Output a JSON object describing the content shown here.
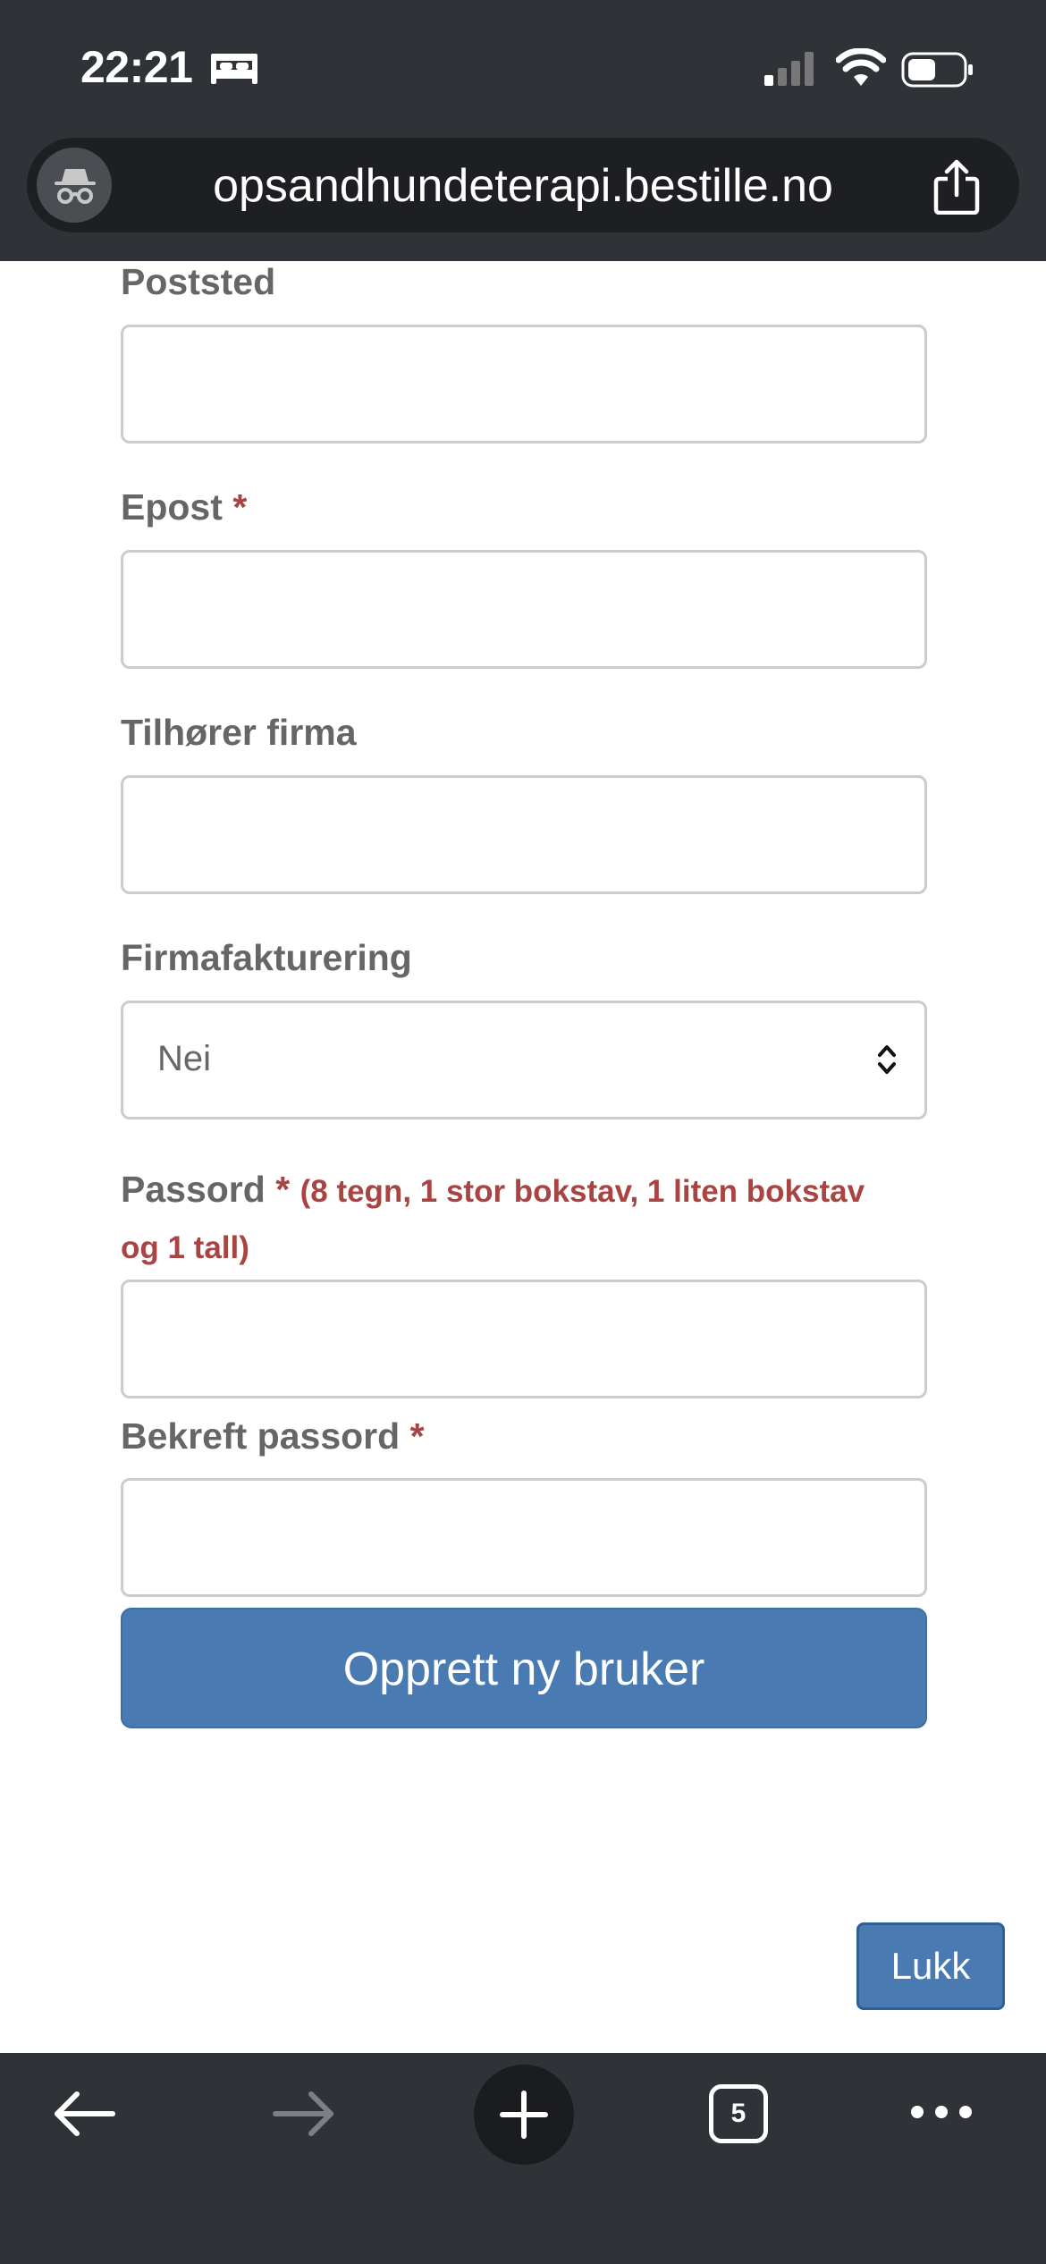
{
  "status_bar": {
    "time": "22:21",
    "icons": [
      "bed-icon",
      "signal-icon",
      "wifi-icon",
      "battery-icon"
    ]
  },
  "browser": {
    "url": "opsandhundeterapi.bestille.no",
    "left_icon": "incognito-icon",
    "right_icon": "share-icon"
  },
  "form": {
    "poststed_label": "Poststed",
    "epost_label": "Epost",
    "required_marker": "*",
    "firma_label": "Tilhører firma",
    "fakturering_label": "Firmafakturering",
    "fakturering_value": "Nei",
    "passord_label": "Passord",
    "passord_hint_line1": "(8 tegn, 1 stor bokstav, 1 liten bokstav",
    "passord_hint_line2": "og 1 tall)",
    "bekreft_label": "Bekreft passord",
    "submit_label": "Opprett ny bruker"
  },
  "modal_footer": {
    "close_label": "Lukk"
  },
  "toolbar": {
    "tab_count": "5",
    "icons": [
      "back-icon",
      "forward-icon",
      "new-tab-icon",
      "tabs-icon",
      "more-icon"
    ]
  },
  "colors": {
    "chrome": "#2f3236",
    "primary": "#4a7ab2",
    "required": "#a94442",
    "label": "#666666"
  }
}
